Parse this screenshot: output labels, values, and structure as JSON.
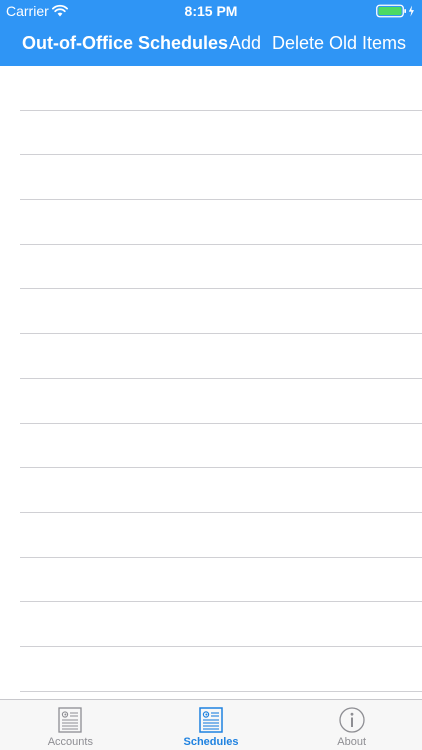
{
  "status_bar": {
    "carrier": "Carrier",
    "time": "8:15 PM",
    "battery_color": "#4cd964"
  },
  "navbar": {
    "title": "Out-of-Office Schedules",
    "add_label": "Add",
    "delete_label": "Delete Old Items",
    "background": "#2f95f5"
  },
  "table": {
    "rows": [
      "",
      "",
      "",
      "",
      "",
      "",
      "",
      "",
      "",
      "",
      "",
      "",
      "",
      "",
      ""
    ]
  },
  "tabbar": {
    "tabs": [
      {
        "label": "Accounts",
        "icon": "accounts-icon",
        "active": false
      },
      {
        "label": "Schedules",
        "icon": "schedules-icon",
        "active": true
      },
      {
        "label": "About",
        "icon": "info-icon",
        "active": false
      }
    ],
    "active_color": "#1f82e0",
    "inactive_color": "#8e8e93"
  }
}
